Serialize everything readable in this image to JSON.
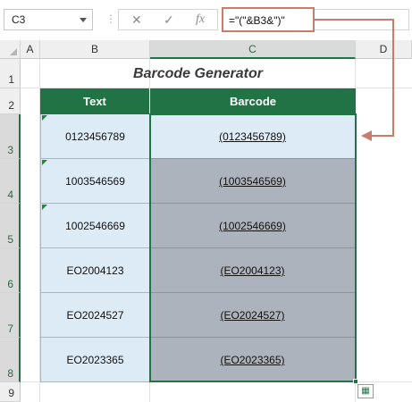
{
  "formula_bar": {
    "name_box": "C3",
    "cancel_icon": "✕",
    "enter_icon": "✓",
    "fx_label": "fx",
    "formula": "=\"(\"&B3&\")\""
  },
  "columns": [
    "A",
    "B",
    "C",
    "D"
  ],
  "rows": [
    "1",
    "2",
    "3",
    "4",
    "5",
    "6",
    "7",
    "8",
    "9"
  ],
  "title": "Barcode Generator",
  "table": {
    "headers": [
      "Text",
      "Barcode"
    ],
    "rows": [
      {
        "text": "0123456789",
        "barcode": "(0123456789)"
      },
      {
        "text": "1003546569",
        "barcode": "(1003546569)"
      },
      {
        "text": "1002546669",
        "barcode": "(1002546669)"
      },
      {
        "text": "EO2004123",
        "barcode": "(EO2004123)"
      },
      {
        "text": "EO2024527",
        "barcode": "(EO2024527)"
      },
      {
        "text": "EO2023365",
        "barcode": "(EO2023365)"
      }
    ]
  },
  "colors": {
    "header_green": "#217346",
    "text_cell_fill": "#ddebf7",
    "barcode_cell_fill": "#adb3bc",
    "callout_arrow": "#c77d6a"
  },
  "icons": {
    "quick_analysis": "quick-analysis-icon"
  }
}
